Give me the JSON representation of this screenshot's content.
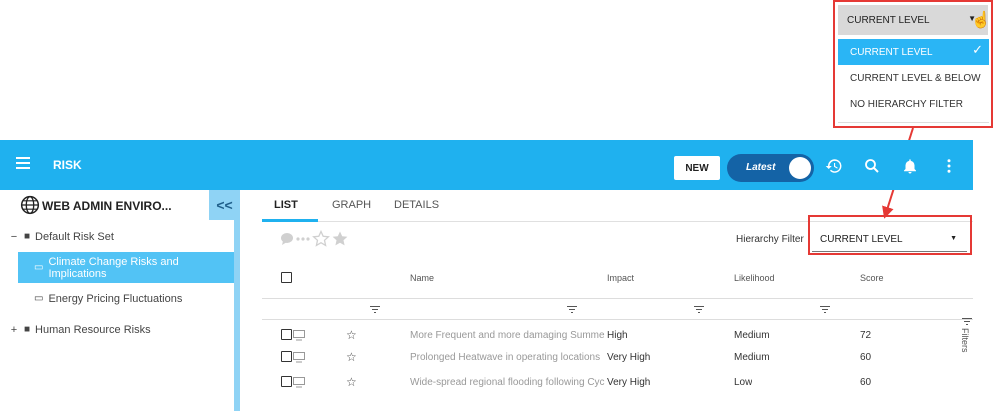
{
  "callout_dropdown": {
    "current_value": "CURRENT LEVEL",
    "options": [
      {
        "label": "CURRENT LEVEL",
        "selected": true
      },
      {
        "label": "CURRENT LEVEL & BELOW",
        "selected": false
      },
      {
        "label": "NO HIERARCHY FILTER",
        "selected": false
      }
    ]
  },
  "appbar": {
    "title": "RISK",
    "new_label": "NEW",
    "toggle_label": "Latest",
    "icons": [
      "history-icon",
      "search-icon",
      "bell-icon",
      "more-vert-icon"
    ],
    "color": "#1fb1ef"
  },
  "sidebar": {
    "environment": "WEB ADMIN ENVIRO...",
    "collapse_glyph": "<<",
    "tree": [
      {
        "label": "Default Risk Set",
        "toggle": "−",
        "icon": "briefcase-icon"
      },
      {
        "label": "Climate Change Risks and Implications",
        "icon": "folder-icon",
        "selected": true
      },
      {
        "label": "Energy Pricing Fluctuations",
        "icon": "folder-icon"
      },
      {
        "label": "Human Resource Risks",
        "toggle": "+",
        "icon": "briefcase-icon"
      }
    ]
  },
  "tabs": [
    {
      "label": "LIST",
      "active": true
    },
    {
      "label": "GRAPH",
      "active": false
    },
    {
      "label": "DETAILS",
      "active": false
    }
  ],
  "hierarchy_filter": {
    "label": "Hierarchy Filter",
    "value": "CURRENT LEVEL"
  },
  "table": {
    "columns": [
      "Name",
      "Impact",
      "Likelihood",
      "Score"
    ],
    "rows": [
      {
        "name": "More Frequent and more damaging Summer",
        "impact": "High",
        "likelihood": "Medium",
        "score": "72"
      },
      {
        "name": "Prolonged Heatwave in operating locations",
        "impact": "Very High",
        "likelihood": "Medium",
        "score": "60"
      },
      {
        "name": "Wide-spread regional flooding following Cycl",
        "impact": "Very High",
        "likelihood": "Low",
        "score": "60"
      }
    ]
  },
  "filters_label": "Filters",
  "highlight_color": "#e53935"
}
